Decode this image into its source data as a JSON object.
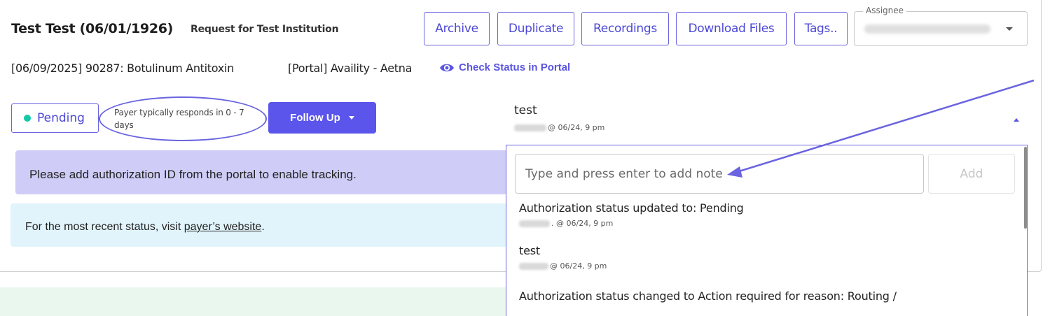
{
  "header": {
    "patient_name": "Test Test (06/01/1926)",
    "request_for": "Request for Test Institution",
    "buttons": {
      "archive": "Archive",
      "duplicate": "Duplicate",
      "recordings": "Recordings",
      "download_files": "Download Files",
      "tags": "Tags.."
    },
    "assignee": {
      "label": "Assignee"
    }
  },
  "subline": {
    "procedure": "[06/09/2025] 90287: Botulinum Antitoxin",
    "portal": "[Portal] Availity - Aetna",
    "check_status": "Check Status in Portal",
    "eye_icon": "eye-icon"
  },
  "status": {
    "badge": "Pending",
    "badge_color": "#12c9a8",
    "response_time": "Payer typically responds in 0 - 7 days",
    "follow_up": "Follow Up"
  },
  "alerts": {
    "authorization": "Please add authorization ID from the portal to enable tracking.",
    "recent_status_prefix": "For the most recent status, visit ",
    "recent_status_link": "payer’s website",
    "recent_status_suffix": "."
  },
  "notes": {
    "latest_title": "test",
    "latest_meta": "@ 06/24, 9 pm",
    "input_placeholder": "Type and press enter to add note",
    "add_label": "Add",
    "items": [
      {
        "text": "Authorization status updated to: Pending",
        "meta": ". @ 06/24, 9 pm"
      },
      {
        "text": "test",
        "meta": "@ 06/24, 9 pm"
      },
      {
        "text": "Authorization status changed to Action required for reason: Routing /",
        "meta": ""
      }
    ]
  },
  "colors": {
    "accent": "#5b55ec",
    "alert_purple": "#cfcdf7",
    "alert_blue": "#e1f4fc"
  }
}
